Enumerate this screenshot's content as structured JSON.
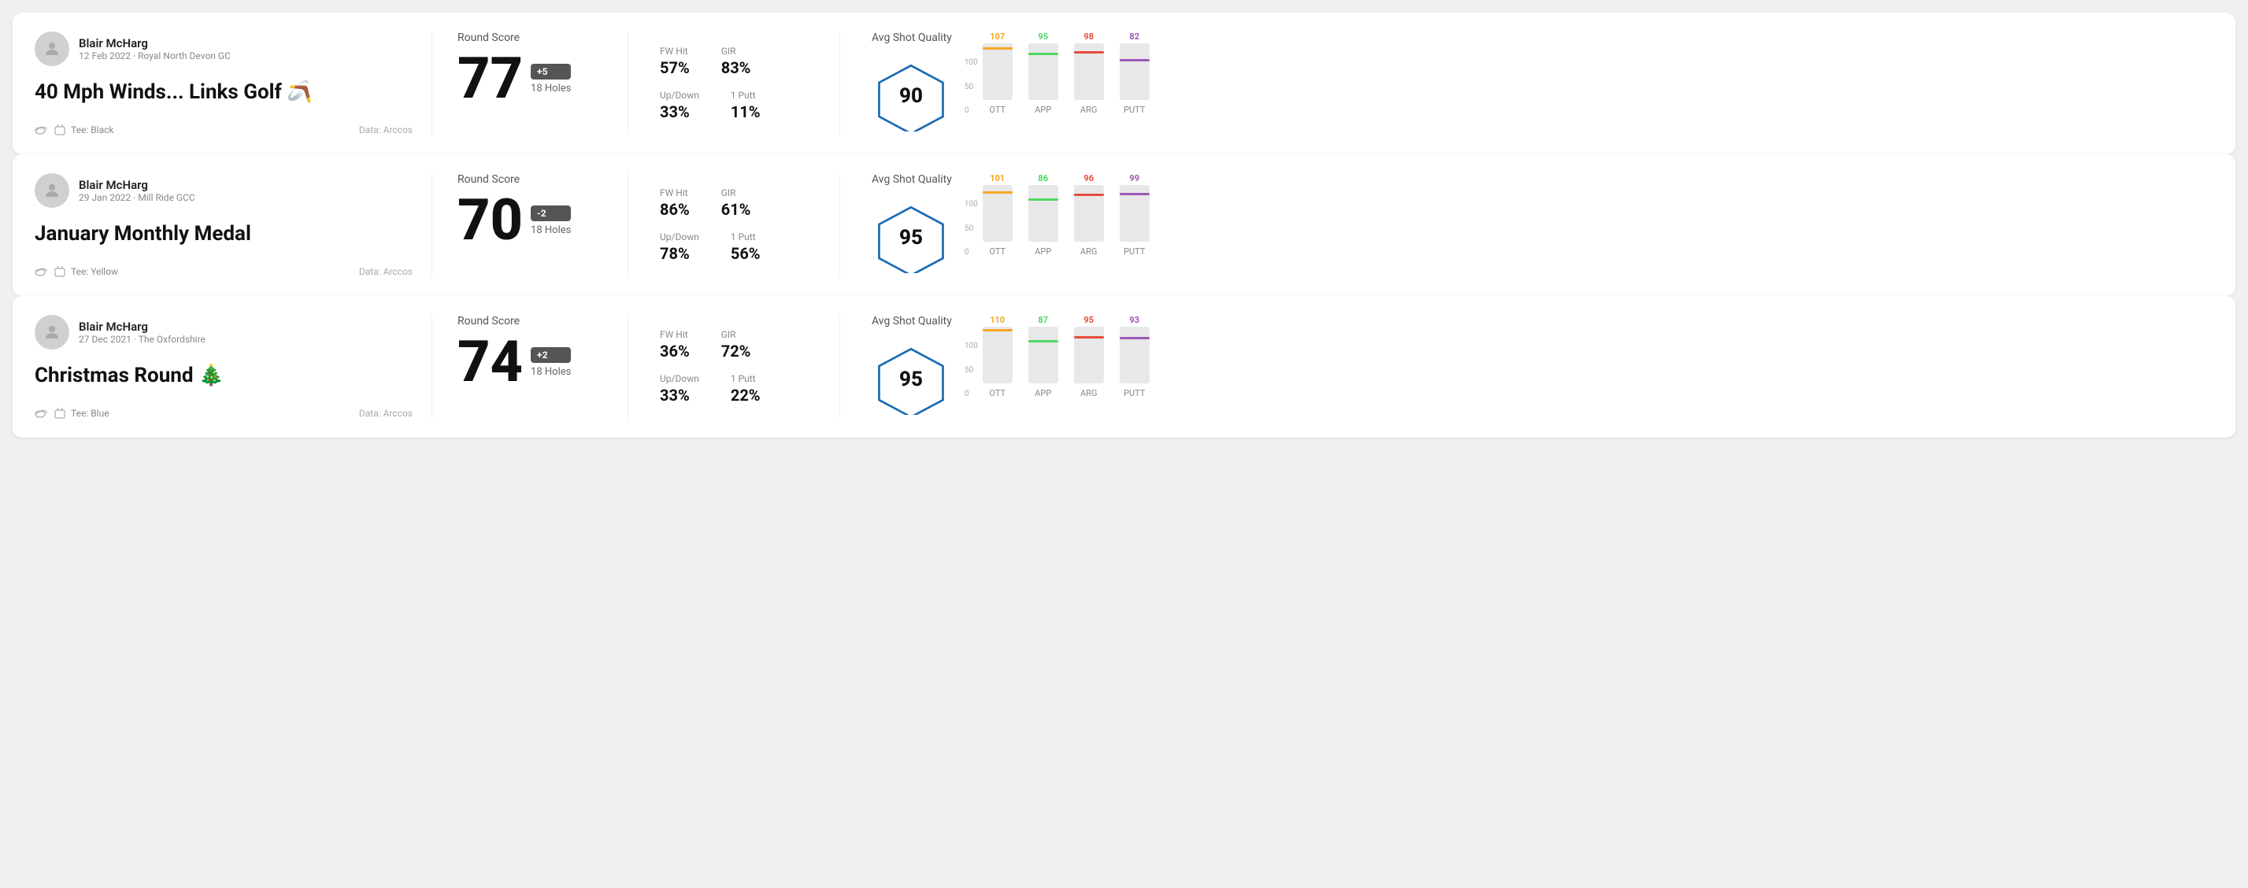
{
  "rounds": [
    {
      "id": "round-1",
      "user": {
        "name": "Blair McHarg",
        "meta": "12 Feb 2022 · Royal North Devon GC"
      },
      "title": "40 Mph Winds... Links Golf",
      "title_emoji": "🪃",
      "tee": "Black",
      "data_source": "Data: Arccos",
      "score": "77",
      "score_badge": "+5",
      "holes": "18 Holes",
      "fw_hit": "57%",
      "gir": "83%",
      "up_down": "33%",
      "one_putt": "11%",
      "avg_shot_quality_label": "Avg Shot Quality",
      "avg_shot_quality_score": "90",
      "chart": {
        "bars": [
          {
            "label": "OTT",
            "value": 107,
            "color": "#f5a623",
            "max": 120
          },
          {
            "label": "APP",
            "value": 95,
            "color": "#4cd964",
            "max": 120
          },
          {
            "label": "ARG",
            "value": 98,
            "color": "#e74c3c",
            "max": 120
          },
          {
            "label": "PUTT",
            "value": 82,
            "color": "#9b59b6",
            "max": 120
          }
        ],
        "y_labels": [
          "100",
          "50",
          "0"
        ]
      }
    },
    {
      "id": "round-2",
      "user": {
        "name": "Blair McHarg",
        "meta": "29 Jan 2022 · Mill Ride GCC"
      },
      "title": "January Monthly Medal",
      "title_emoji": "",
      "tee": "Yellow",
      "data_source": "Data: Arccos",
      "score": "70",
      "score_badge": "-2",
      "holes": "18 Holes",
      "fw_hit": "86%",
      "gir": "61%",
      "up_down": "78%",
      "one_putt": "56%",
      "avg_shot_quality_label": "Avg Shot Quality",
      "avg_shot_quality_score": "95",
      "chart": {
        "bars": [
          {
            "label": "OTT",
            "value": 101,
            "color": "#f5a623",
            "max": 120
          },
          {
            "label": "APP",
            "value": 86,
            "color": "#4cd964",
            "max": 120
          },
          {
            "label": "ARG",
            "value": 96,
            "color": "#e74c3c",
            "max": 120
          },
          {
            "label": "PUTT",
            "value": 99,
            "color": "#9b59b6",
            "max": 120
          }
        ],
        "y_labels": [
          "100",
          "50",
          "0"
        ]
      }
    },
    {
      "id": "round-3",
      "user": {
        "name": "Blair McHarg",
        "meta": "27 Dec 2021 · The Oxfordshire"
      },
      "title": "Christmas Round",
      "title_emoji": "🎄",
      "tee": "Blue",
      "data_source": "Data: Arccos",
      "score": "74",
      "score_badge": "+2",
      "holes": "18 Holes",
      "fw_hit": "36%",
      "gir": "72%",
      "up_down": "33%",
      "one_putt": "22%",
      "avg_shot_quality_label": "Avg Shot Quality",
      "avg_shot_quality_score": "95",
      "chart": {
        "bars": [
          {
            "label": "OTT",
            "value": 110,
            "color": "#f5a623",
            "max": 120
          },
          {
            "label": "APP",
            "value": 87,
            "color": "#4cd964",
            "max": 120
          },
          {
            "label": "ARG",
            "value": 95,
            "color": "#e74c3c",
            "max": 120
          },
          {
            "label": "PUTT",
            "value": 93,
            "color": "#9b59b6",
            "max": 120
          }
        ],
        "y_labels": [
          "100",
          "50",
          "0"
        ]
      }
    }
  ],
  "labels": {
    "round_score": "Round Score",
    "fw_hit": "FW Hit",
    "gir": "GIR",
    "up_down": "Up/Down",
    "one_putt": "1 Putt",
    "tee_prefix": "Tee:"
  }
}
